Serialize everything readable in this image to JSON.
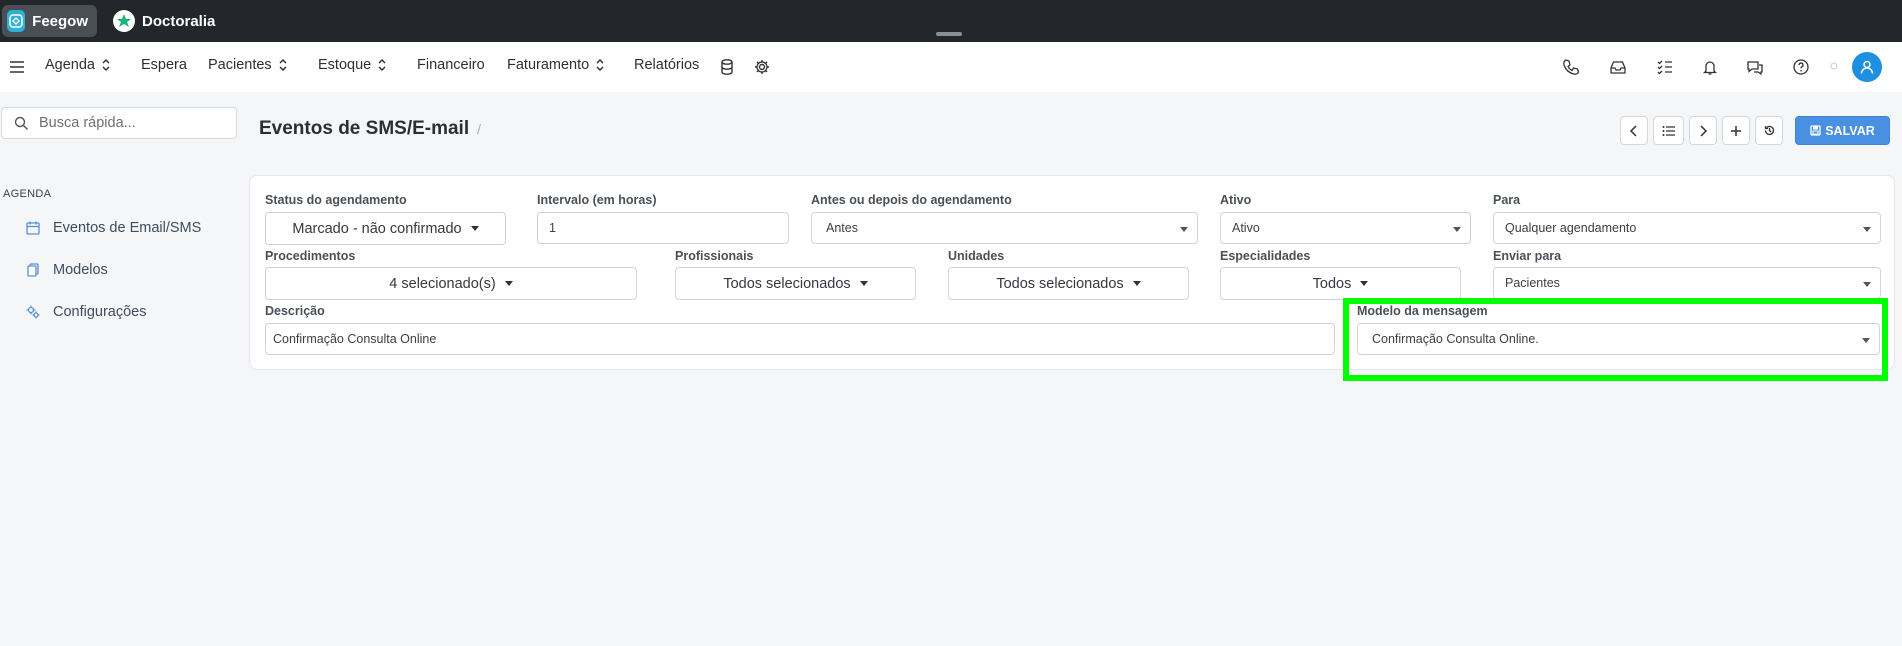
{
  "topbar": {
    "tabs": [
      {
        "label": "Feegow",
        "icon": "feegow-logo"
      },
      {
        "label": "Doctoralia",
        "icon": "doctoralia-logo"
      }
    ]
  },
  "nav": {
    "items": [
      {
        "label": "Agenda",
        "has_dropdown": true
      },
      {
        "label": "Espera",
        "has_dropdown": false
      },
      {
        "label": "Pacientes",
        "has_dropdown": true
      },
      {
        "label": "Estoque",
        "has_dropdown": true
      },
      {
        "label": "Financeiro",
        "has_dropdown": false
      },
      {
        "label": "Faturamento",
        "has_dropdown": true
      },
      {
        "label": "Relatórios",
        "has_dropdown": false
      }
    ],
    "icons": [
      "database-icon",
      "gear-icon"
    ],
    "right_icons": [
      "phone-icon",
      "inbox-icon",
      "checklist-icon",
      "bell-icon",
      "chat-icon",
      "help-icon"
    ],
    "avatar_color": "#1e8fe1"
  },
  "sidebar": {
    "search_placeholder": "Busca rápida...",
    "section": "AGENDA",
    "items": [
      {
        "label": "Eventos de Email/SMS",
        "icon": "calendar-icon"
      },
      {
        "label": "Modelos",
        "icon": "copy-icon"
      },
      {
        "label": "Configurações",
        "icon": "cogs-icon"
      }
    ]
  },
  "header": {
    "title": "Eventos de SMS/E-mail",
    "separator": "/",
    "save_label": "SALVAR",
    "accent": "#4a90e2"
  },
  "form": {
    "status": {
      "label": "Status do agendamento",
      "value": "Marcado - não confirmado"
    },
    "intervalo": {
      "label": "Intervalo (em horas)",
      "value": "1"
    },
    "antes_depois": {
      "label": "Antes ou depois do agendamento",
      "value": "Antes"
    },
    "ativo": {
      "label": "Ativo",
      "value": "Ativo"
    },
    "para": {
      "label": "Para",
      "value": "Qualquer agendamento"
    },
    "procedimentos": {
      "label": "Procedimentos",
      "value": "4 selecionado(s)"
    },
    "profissionais": {
      "label": "Profissionais",
      "value": "Todos selecionados"
    },
    "unidades": {
      "label": "Unidades",
      "value": "Todos selecionados"
    },
    "especialidades": {
      "label": "Especialidades",
      "value": "Todos"
    },
    "enviar_para": {
      "label": "Enviar para",
      "value": "Pacientes"
    },
    "descricao": {
      "label": "Descrição",
      "value": "Confirmação Consulta Online"
    },
    "modelo": {
      "label": "Modelo da mensagem",
      "value": "Confirmação Consulta Online."
    }
  },
  "highlight_color": "#00ff00"
}
